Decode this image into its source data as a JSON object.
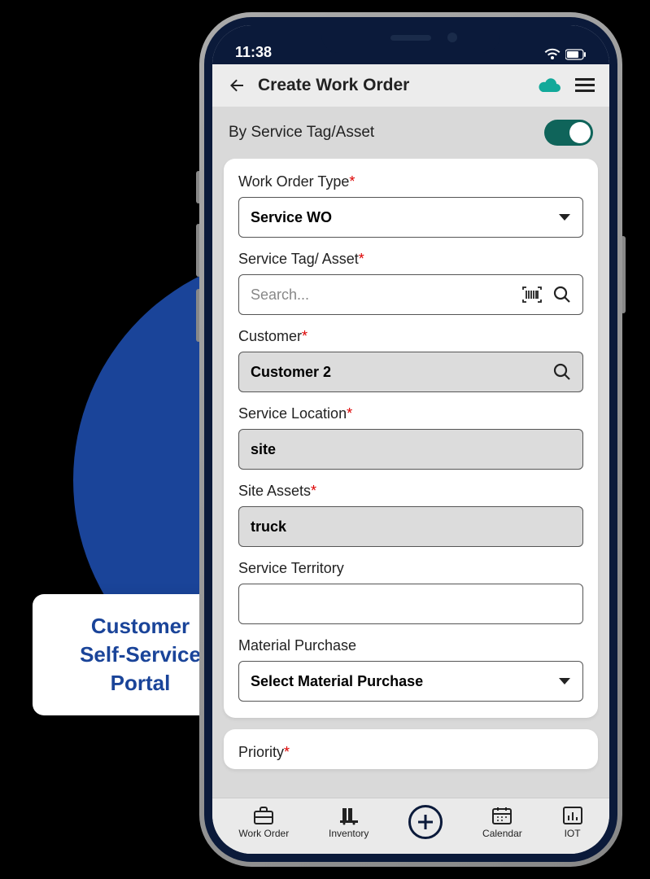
{
  "status": {
    "time": "11:38"
  },
  "header": {
    "title": "Create Work Order"
  },
  "toggle": {
    "label": "By Service Tag/Asset",
    "on": true
  },
  "form": {
    "work_order_type": {
      "label": "Work Order Type",
      "required": true,
      "value": "Service WO"
    },
    "service_tag": {
      "label": "Service Tag/ Asset",
      "required": true,
      "placeholder": "Search..."
    },
    "customer": {
      "label": "Customer",
      "required": true,
      "value": "Customer 2"
    },
    "service_location": {
      "label": "Service Location",
      "required": true,
      "value": "site"
    },
    "site_assets": {
      "label": "Site Assets",
      "required": true,
      "value": "truck"
    },
    "service_territory": {
      "label": "Service Territory",
      "required": false,
      "value": ""
    },
    "material_purchase": {
      "label": "Material Purchase",
      "required": false,
      "value": "Select Material Purchase"
    },
    "priority": {
      "label": "Priority",
      "required": true
    }
  },
  "nav": {
    "work_order": "Work Order",
    "inventory": "Inventory",
    "calendar": "Calendar",
    "iot": "IOT"
  },
  "portal_card": {
    "line1": "Customer",
    "line2": "Self-Service",
    "line3": "Portal"
  }
}
